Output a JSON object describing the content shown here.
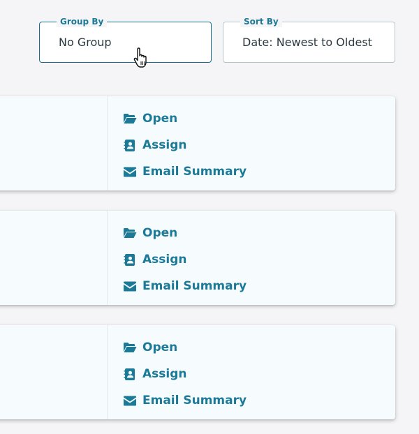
{
  "filters": {
    "group_by": {
      "label": "Group By",
      "value": "No Group"
    },
    "sort_by": {
      "label": "Sort By",
      "value": "Date: Newest to Oldest"
    }
  },
  "cards": [
    {
      "actions": {
        "open_label": "Open",
        "assign_label": "Assign",
        "email_label": "Email Summary"
      }
    },
    {
      "actions": {
        "open_label": "Open",
        "assign_label": "Assign",
        "email_label": "Email Summary"
      }
    },
    {
      "actions": {
        "open_label": "Open",
        "assign_label": "Assign",
        "email_label": "Email Summary"
      }
    }
  ],
  "icons": {
    "open": "folder-open-icon",
    "assign": "contact-book-icon",
    "email": "envelope-icon",
    "cursor": "hand-pointer-icon"
  },
  "colors": {
    "accent": "#1c7a99",
    "card_background": "#f6fcfd",
    "page_background": "#f5f5f7"
  }
}
